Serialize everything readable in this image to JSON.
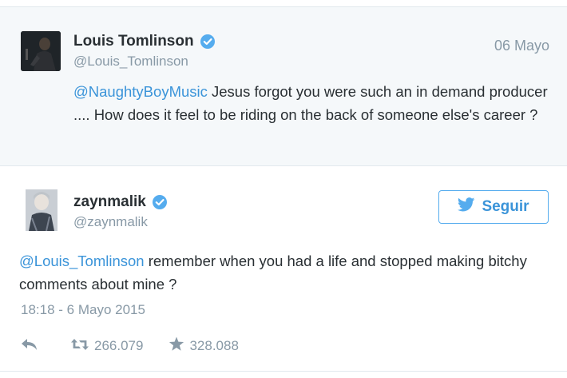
{
  "quoted_tweet": {
    "name": "Louis Tomlinson",
    "handle": "@Louis_Tomlinson",
    "date": "06 Mayo",
    "mention": "@NaughtyBoyMusic",
    "text": " Jesus forgot you were such an in demand producer .... How does it feel to be riding on the back of someone else's career ?"
  },
  "main_tweet": {
    "name": "zaynmalik",
    "handle": "@zaynmalik",
    "follow_label": "Seguir",
    "mention": "@Louis_Tomlinson",
    "text": " remember when you had a life and stopped making bitchy comments about mine ?",
    "timestamp": "18:18 - 6 Mayo 2015",
    "retweets": "266.079",
    "favorites": "328.088"
  },
  "icons": {
    "verified": "verified-badge-icon",
    "twitter_bird": "twitter-bird-icon",
    "reply": "reply-icon",
    "retweet": "retweet-icon",
    "favorite": "star-icon"
  },
  "colors": {
    "accent": "#3b94d9",
    "verified": "#55acee",
    "muted": "#8899a6",
    "quoted_bg": "#f5f8fa"
  }
}
